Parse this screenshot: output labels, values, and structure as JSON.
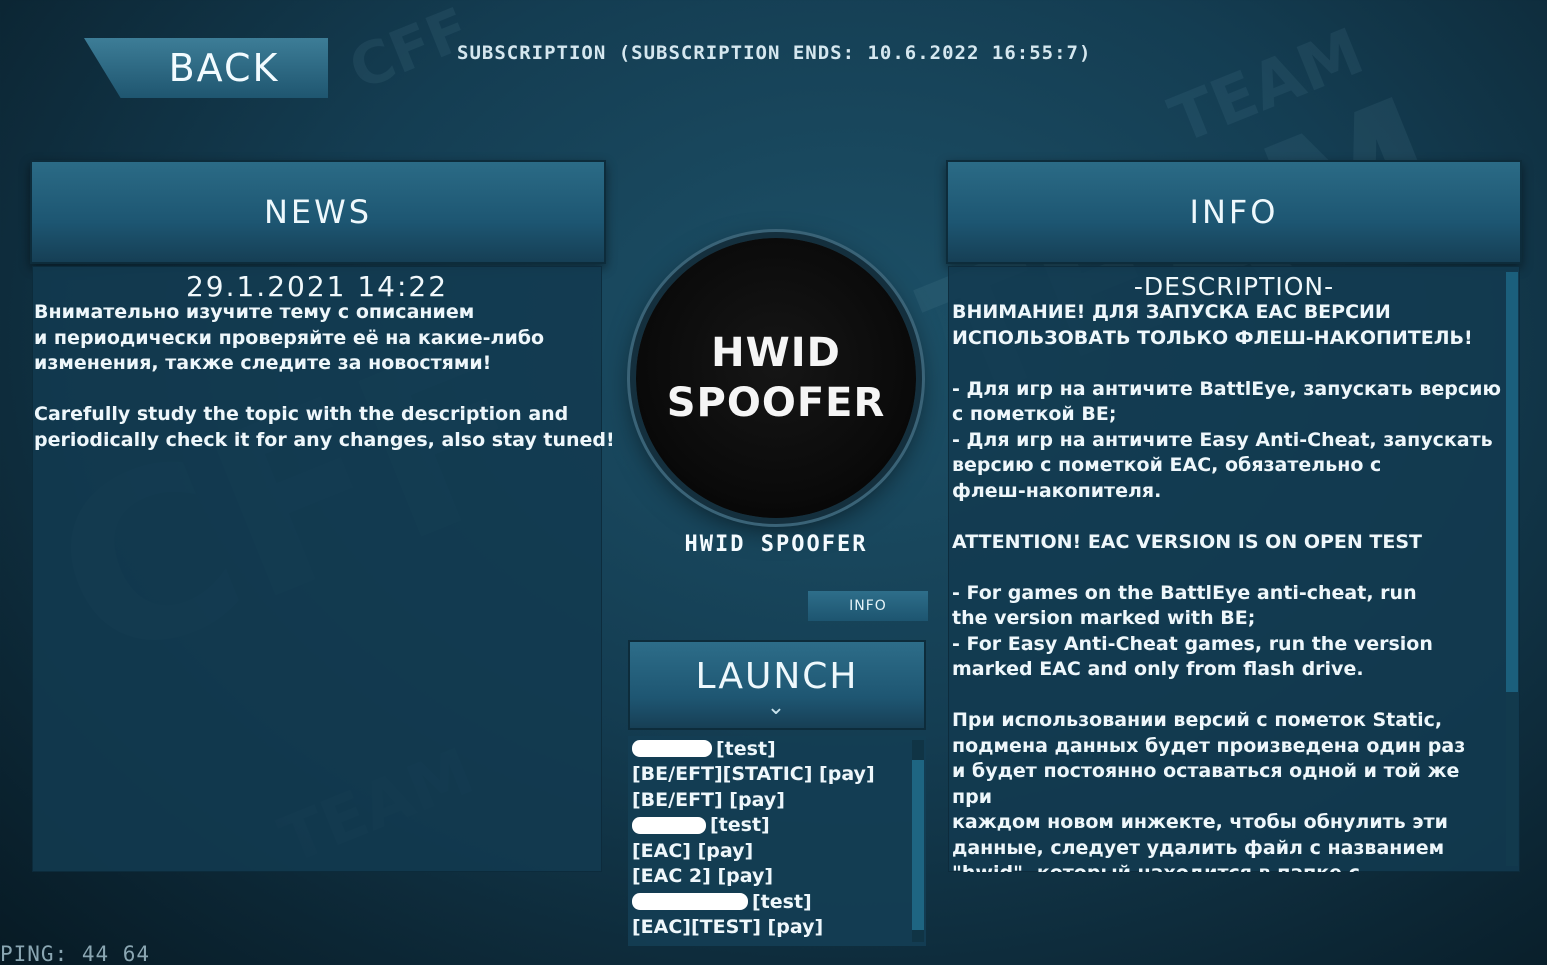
{
  "top": {
    "back_label": "BACK",
    "subscription_text": "SUBSCRIPTION (SUBSCRIPTION ENDS: 10.6.2022 16:55:7)"
  },
  "news": {
    "title": "NEWS",
    "date": "29.1.2021  14:22",
    "text_ru": "Внимательно изучите тему с описанием\nи периодически проверяйте её на какие-либо\nизменения, также следите за новостями!",
    "text_en": "Carefully study the topic with the description and\nperiodically check it for any changes, also stay tuned!"
  },
  "product": {
    "logo_line1": "HWID",
    "logo_line2": "SPOOFER",
    "name": "HWID SPOOFER",
    "info_label": "INFO",
    "launch_label": "LAUNCH",
    "launch_chevron": "⌄"
  },
  "versions": [
    {
      "label": "[test]",
      "redacted": true
    },
    {
      "label": "[BE/EFT][STATIC] [pay]",
      "redacted": false
    },
    {
      "label": "[BE/EFT] [pay]",
      "redacted": false
    },
    {
      "label": "[test]",
      "redacted": true
    },
    {
      "label": "[EAC] [pay]",
      "redacted": false
    },
    {
      "label": "[EAC 2] [pay]",
      "redacted": false
    },
    {
      "label": "[test]",
      "redacted": true
    },
    {
      "label": "[EAC][TEST] [pay]",
      "redacted": false
    }
  ],
  "info": {
    "title": "INFO",
    "heading": "-DESCRIPTION-",
    "body": "ВНИМАНИЕ! ДЛЯ ЗАПУСКА EAC ВЕРСИИ\nИСПОЛЬЗОВАТЬ ТОЛЬКО ФЛЕШ-НАКОПИТЕЛЬ!\n\n- Для игр на античите BattlEye, запускать версию\nс пометкой BE;\n- Для игр на античите Easy Anti-Cheat, запускать\nверсию с пометкой EAC, обязательно с\nфлеш-накопителя.\n\nATTENTION! EAC VERSION IS ON OPEN TEST\n\n- For games on the BattlEye anti-cheat, run\nthe version marked with BE;\n- For Easy Anti-Cheat games, run the version\nmarked EAC and only from flash drive.\n\nПри использовании версий с пометок Static,\nподмена данных будет произведена один раз\nи будет постоянно оставаться одной и той же при\nкаждом новом инжекте, чтобы обнулить эти\nданные, следует удалить файл с названием\n\"hwid\", который находится в папке с\nлоадером, после удаления не забыть по"
  },
  "status": {
    "ping_text": "PING: 44 64"
  },
  "watermark": {
    "brand": "CFF",
    "team": "TEAM"
  }
}
